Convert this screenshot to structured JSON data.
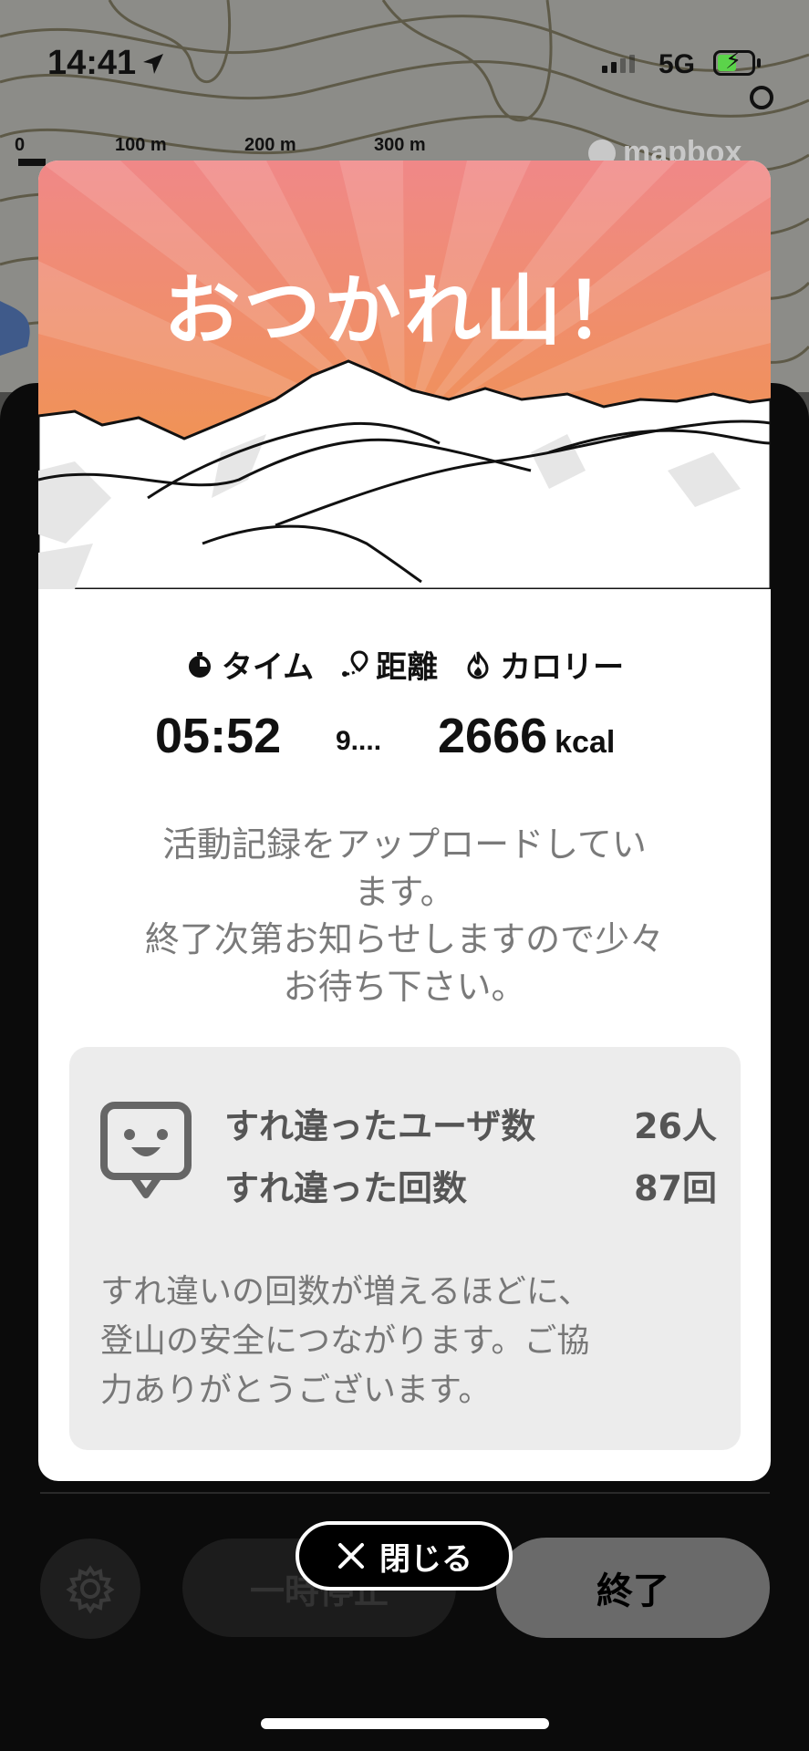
{
  "status_bar": {
    "time": "14:41",
    "network": "5G"
  },
  "map": {
    "scale_labels": [
      "0",
      "100 m",
      "200 m",
      "300 m"
    ],
    "attribution": "mapbox"
  },
  "modal": {
    "title": "おつかれ山！",
    "stats": {
      "time_label": "タイム",
      "distance_label": "距離",
      "calorie_label": "カロリー",
      "time_value": "05:52",
      "distance_value": "9....",
      "calorie_value": "2666",
      "calorie_unit": "kcal"
    },
    "upload_message": {
      "line1": "活動記録をアップロードしてい",
      "line2": "ます。",
      "line3": "終了次第お知らせしますので少々",
      "line4": "お待ち下さい。"
    },
    "passing": {
      "users_label": "すれ違ったユーザ数",
      "users_value": "26人",
      "count_label": "すれ違った回数",
      "count_value": "87回",
      "note_line1": "すれ違いの回数が増えるほどに、",
      "note_line2": "登山の安全につながります。ご協",
      "note_line3": "力ありがとうございます。"
    }
  },
  "controls": {
    "pause_label": "一時停止",
    "end_label": "終了",
    "close_label": "閉じる"
  },
  "colors": {
    "hero_top": "#f08a8a",
    "hero_bottom": "#f0964a",
    "card_bg": "#ececec"
  }
}
